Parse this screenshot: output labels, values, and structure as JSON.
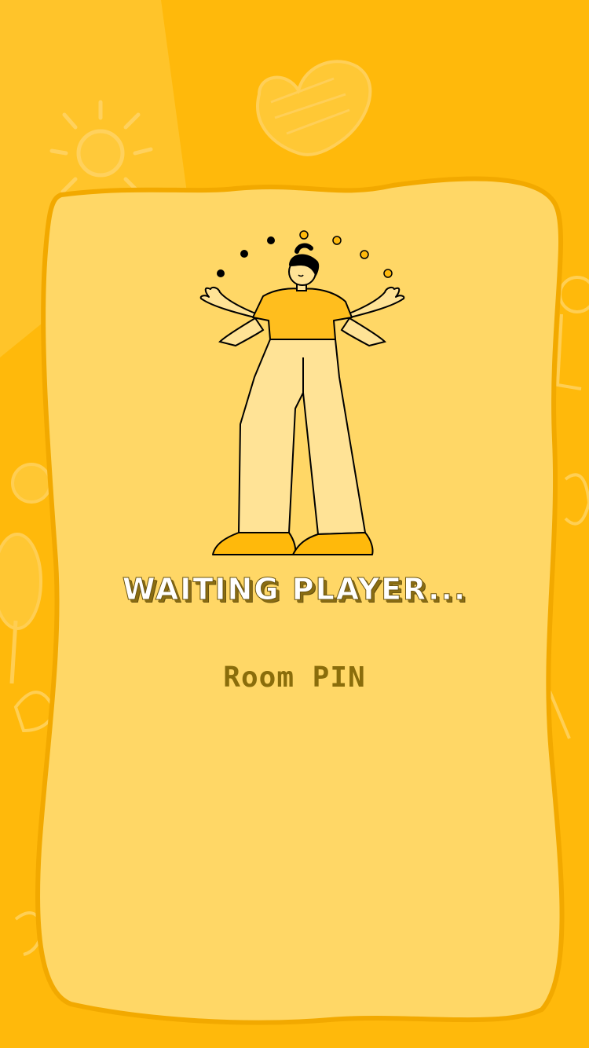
{
  "screen": {
    "title": "WAITING PLAYER...",
    "room_pin_label": "Room PIN"
  },
  "colors": {
    "background": "#FFB90B",
    "background_light": "#FFC42A",
    "card_fill": "#FFD766",
    "card_border": "#F2A900",
    "shirt": "#FFBE1E",
    "pants": "#FFE396",
    "shoes": "#FFB90B",
    "title_text": "#FFFFFF",
    "title_shadow": "#6B5410",
    "pin_text": "#8A6D0B"
  },
  "icons": {
    "hero": "juggling-person-illustration",
    "decor": [
      "sun-doodle-icon",
      "heart-doodle-icon",
      "tree-doodle-icon",
      "character-doodle-icon"
    ]
  }
}
